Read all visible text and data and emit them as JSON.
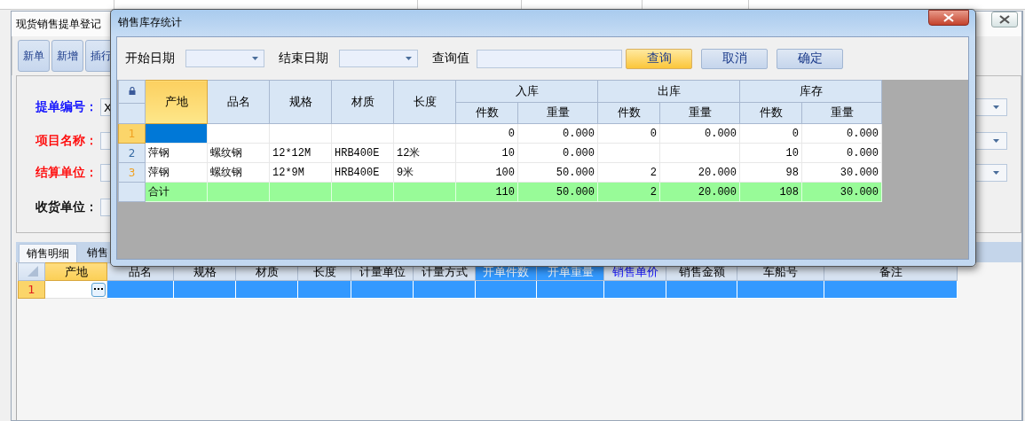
{
  "background_window": {
    "title": "现货销售提单登记",
    "toolbar": [
      {
        "label": "新单"
      },
      {
        "label": "新增"
      },
      {
        "label": "插行"
      }
    ],
    "form": [
      {
        "label": "提单编号：",
        "color": "#0000ff",
        "value": "X",
        "kind": "dropdown"
      },
      {
        "label": "项目名称：",
        "color": "#ff0000",
        "kind": "dropdown"
      },
      {
        "label": "结算单位：",
        "color": "#ff0000",
        "kind": "dropdown"
      },
      {
        "label": "收货单位：",
        "color": "#000000",
        "kind": "text"
      }
    ],
    "tabs": [
      {
        "label": "销售明细",
        "selected": true
      },
      {
        "label": "销售",
        "selected": false
      }
    ],
    "grid": {
      "columns": [
        {
          "label": "产地",
          "kind": "frozen"
        },
        {
          "label": "品名",
          "kind": "normal"
        },
        {
          "label": "规格",
          "kind": "normal"
        },
        {
          "label": "材质",
          "kind": "normal"
        },
        {
          "label": "长度",
          "kind": "normal"
        },
        {
          "label": "计量单位",
          "kind": "normal"
        },
        {
          "label": "计量方式",
          "kind": "normal"
        },
        {
          "label": "开单件数",
          "kind": "selected"
        },
        {
          "label": "开单重量",
          "kind": "selected"
        },
        {
          "label": "销售单价",
          "kind": "emphasis"
        },
        {
          "label": "销售金额",
          "kind": "normal"
        },
        {
          "label": "车船号",
          "kind": "normal"
        },
        {
          "label": "备注",
          "kind": "normal"
        }
      ],
      "rows": [
        {
          "number": "1",
          "selected": true
        }
      ]
    }
  },
  "dialog": {
    "title": "销售库存统计",
    "filters": [
      {
        "label": "开始日期",
        "kind": "date"
      },
      {
        "label": "结束日期",
        "kind": "date"
      },
      {
        "label": "查询值",
        "kind": "text"
      }
    ],
    "buttons": [
      {
        "label": "查询",
        "default": true
      },
      {
        "label": "取消",
        "default": false
      },
      {
        "label": "确定",
        "default": false
      }
    ],
    "table": {
      "columns": [
        {
          "label": "产地",
          "kind": "frozen"
        },
        {
          "label": "品名",
          "kind": "normal"
        },
        {
          "label": "规格",
          "kind": "normal"
        },
        {
          "label": "材质",
          "kind": "normal"
        },
        {
          "label": "长度",
          "kind": "normal"
        }
      ],
      "groups": [
        {
          "label": "入库",
          "columns": [
            "件数",
            "重量"
          ]
        },
        {
          "label": "出库",
          "columns": [
            "件数",
            "重量"
          ]
        },
        {
          "label": "库存",
          "columns": [
            "件数",
            "重量"
          ]
        }
      ],
      "rows": [
        {
          "number": "1",
          "selected": true,
          "marked": true,
          "cells": [
            null,
            null,
            null,
            null,
            null,
            "0",
            "0.000",
            "0",
            "0.000",
            "0",
            "0.000"
          ]
        },
        {
          "number": "2",
          "selected": false,
          "marked": false,
          "cells": [
            "萍钢",
            "螺纹钢",
            "12*12M",
            "HRB400E",
            "12米",
            "10",
            "0.000",
            null,
            null,
            "10",
            "0.000"
          ]
        },
        {
          "number": "3",
          "selected": false,
          "marked": true,
          "cells": [
            "萍钢",
            "螺纹钢",
            "12*9M",
            "HRB400E",
            "9米",
            "100",
            "50.000",
            "2",
            "20.000",
            "98",
            "30.000"
          ]
        }
      ],
      "total": {
        "label": "合计",
        "cells": [
          null,
          null,
          null,
          null,
          "110",
          "50.000",
          "2",
          "20.000",
          "108",
          "30.000"
        ]
      }
    }
  }
}
